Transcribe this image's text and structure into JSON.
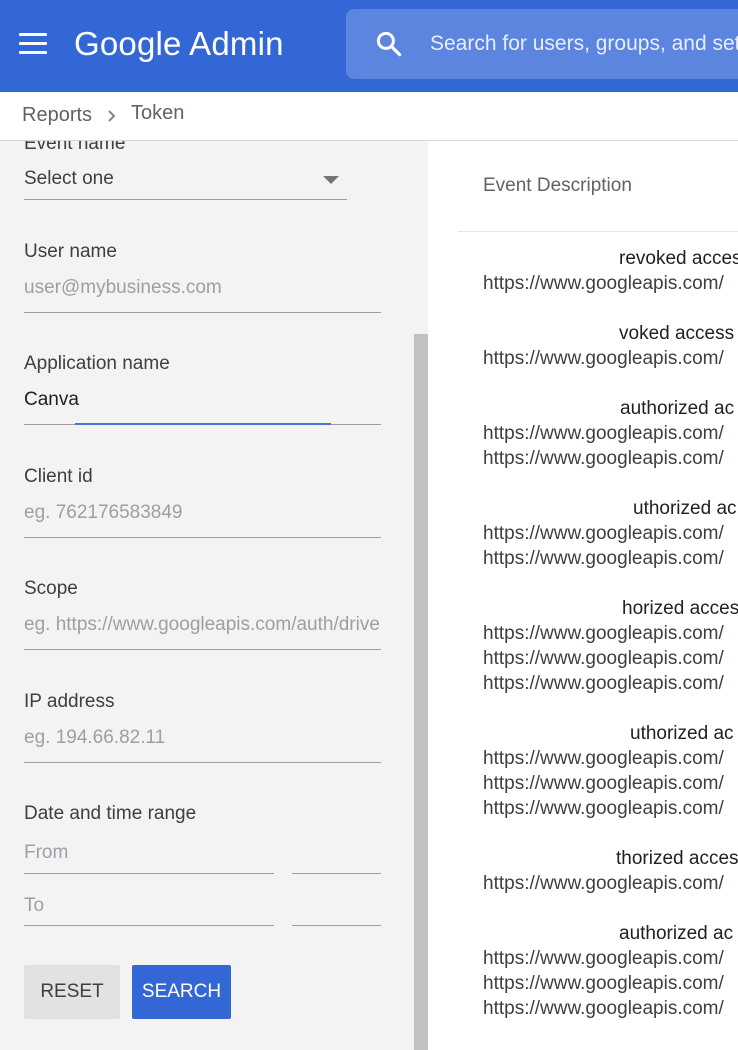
{
  "header": {
    "app_title": "Google Admin",
    "search_placeholder": "Search for users, groups, and settings"
  },
  "breadcrumb": {
    "parent": "Reports",
    "current": "Token"
  },
  "filters": {
    "event_name": {
      "label": "Event name",
      "value": "Select one"
    },
    "user_name": {
      "label": "User name",
      "placeholder": "user@mybusiness.com"
    },
    "application_name": {
      "label": "Application name",
      "value": "Canva"
    },
    "client_id": {
      "label": "Client id",
      "placeholder": "eg. 762176583849"
    },
    "scope": {
      "label": "Scope",
      "placeholder": "eg. https://www.googleapis.com/auth/drive"
    },
    "ip_address": {
      "label": "IP address",
      "placeholder": "eg. 194.66.82.11"
    },
    "date_range": {
      "label": "Date and time range",
      "from_placeholder": "From",
      "to_placeholder": "To"
    },
    "reset_label": "RESET",
    "search_label": "SEARCH"
  },
  "events": {
    "column_header": "Event Description",
    "rows": [
      {
        "title": "revoked access",
        "urls": [
          "https://www.googleapis.com/"
        ]
      },
      {
        "title": "voked access t",
        "urls": [
          "https://www.googleapis.com/"
        ]
      },
      {
        "title": "authorized ac",
        "urls": [
          "https://www.googleapis.com/",
          "https://www.googleapis.com/"
        ]
      },
      {
        "title": "uthorized ac",
        "urls": [
          "https://www.googleapis.com/",
          "https://www.googleapis.com/"
        ]
      },
      {
        "title": "horized acces",
        "urls": [
          "https://www.googleapis.com/",
          "https://www.googleapis.com/",
          "https://www.googleapis.com/"
        ]
      },
      {
        "title": "uthorized ac",
        "urls": [
          "https://www.googleapis.com/",
          "https://www.googleapis.com/",
          "https://www.googleapis.com/"
        ]
      },
      {
        "title": "thorized acces",
        "urls": [
          "https://www.googleapis.com/"
        ]
      },
      {
        "title": "authorized ac",
        "urls": [
          "https://www.googleapis.com/",
          "https://www.googleapis.com/",
          "https://www.googleapis.com/"
        ]
      }
    ]
  },
  "colors": {
    "appbar": "#3367d6",
    "primary_button": "#3367d6",
    "panel_background": "#f3f3f3"
  }
}
